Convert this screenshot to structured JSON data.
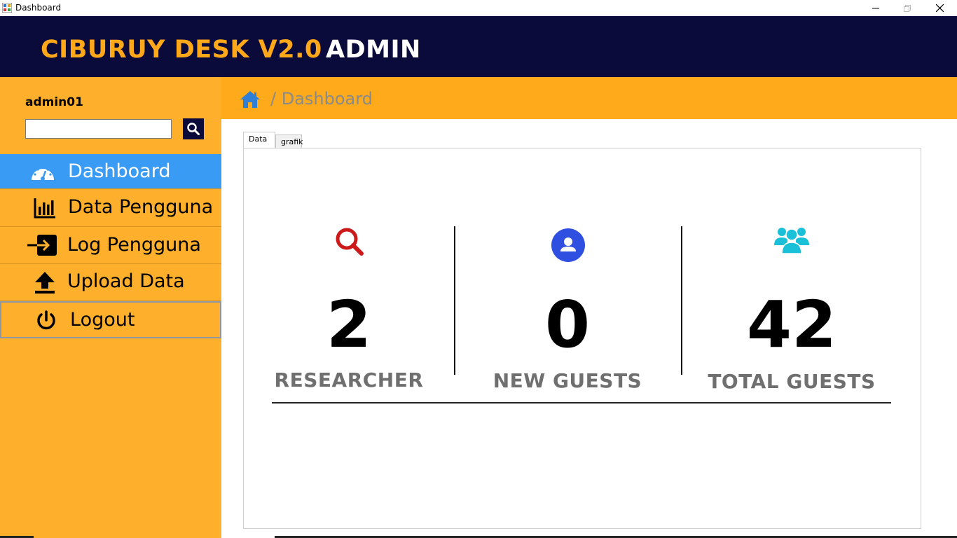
{
  "window": {
    "title": "Dashboard",
    "controls": {
      "minimize": "minimize",
      "maximize": "maximize",
      "close": "close"
    }
  },
  "header": {
    "brand": "CIBURUY DESK V2.0",
    "role": "ADMIN",
    "colors": {
      "background": "#0b0b3b",
      "brand": "#ffa81a",
      "role": "#ffffff"
    }
  },
  "sidebar": {
    "username": "admin01",
    "search": {
      "value": "",
      "placeholder": "",
      "button_icon": "search-icon"
    },
    "items": [
      {
        "label": "Dashboard",
        "icon": "speedometer-icon",
        "active": true
      },
      {
        "label": "Data Pengguna",
        "icon": "bar-chart-icon",
        "active": false
      },
      {
        "label": "Log Pengguna",
        "icon": "login-icon",
        "active": false
      },
      {
        "label": "Upload Data",
        "icon": "upload-icon",
        "active": false
      },
      {
        "label": "Logout",
        "icon": "power-icon",
        "active": false
      }
    ],
    "colors": {
      "background": "#feb02c",
      "active": "#3a9bf4"
    }
  },
  "breadcrumb": {
    "home_icon": "home-icon",
    "separator": "/",
    "current": "Dashboard"
  },
  "tabs": [
    {
      "label": "Data",
      "active": true
    },
    {
      "label": "grafik",
      "active": false
    }
  ],
  "stats": [
    {
      "value": "2",
      "caption": "RESEARCHER",
      "icon": "search-icon",
      "color": "#cc1a1a"
    },
    {
      "value": "0",
      "caption": "NEW GUESTS",
      "icon": "user-icon",
      "color": "#2f4fe0"
    },
    {
      "value": "42",
      "caption": "TOTAL GUESTS",
      "icon": "users-group-icon",
      "color": "#19c0d8"
    }
  ]
}
